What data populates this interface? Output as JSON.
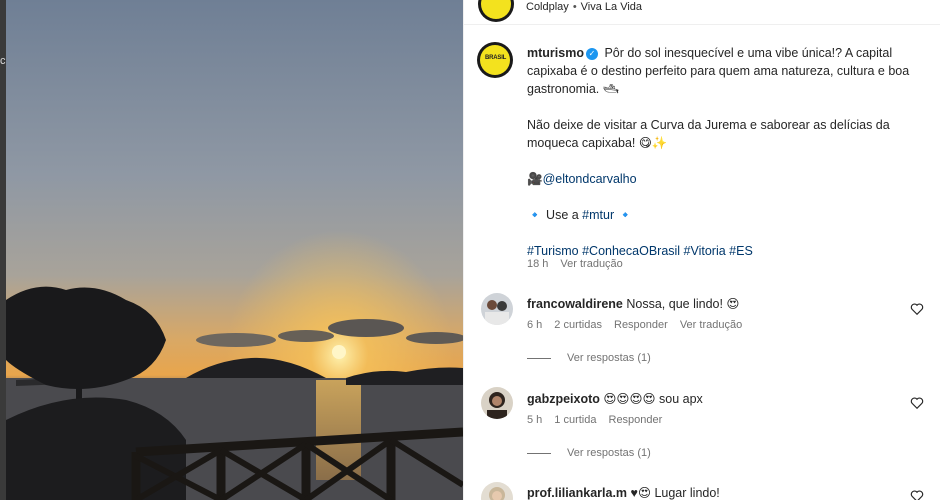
{
  "backdrop": {
    "edge_glyph": "c"
  },
  "post": {
    "account": "mturismo",
    "audio": {
      "artist": "Coldplay",
      "song": "Viva La Vida"
    },
    "avatar_logo": "BRASIL",
    "caption": {
      "line1": "Pôr do sol inesquecível e uma vibe única!? A capital capixaba é o destino perfeito para quem ama natureza, cultura e boa gastronomia. 🛥",
      "line2": "Não deixe de visitar a Curva da Jurema e saborear as delícias da moqueca capixaba! 😋✨",
      "credit_emoji": "🎥",
      "credit_handle": "@eltondcarvalho",
      "use_prefix": "🔹 Use a ",
      "use_tag": "#mtur",
      "use_suffix": " 🔹",
      "hashtags": "#Turismo #ConhecaOBrasil #Vitoria #ES"
    },
    "caption_time": "18 h",
    "see_translation": "Ver tradução"
  },
  "comments": [
    {
      "username": "francowaldirene",
      "text": "Nossa, que lindo! 😍",
      "time": "6 h",
      "likes": "2 curtidas",
      "reply": "Responder",
      "translate": "Ver tradução",
      "view_replies": "Ver respostas (1)"
    },
    {
      "username": "gabzpeixoto",
      "text": "😍😍😍😍 sou apx",
      "time": "5 h",
      "likes": "1 curtida",
      "reply": "Responder",
      "view_replies": "Ver respostas (1)"
    },
    {
      "username": "prof.liliankarla.m",
      "text": "♥😍 Lugar lindo!"
    }
  ],
  "colors": {
    "brand_yellow": "#f3e21e",
    "link_blue": "#00376b",
    "verified_blue": "#1c96f0",
    "muted": "#737373"
  }
}
